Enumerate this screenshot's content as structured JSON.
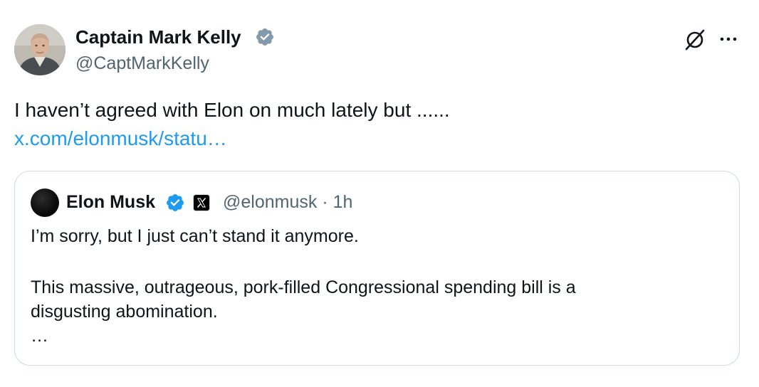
{
  "author": {
    "name": "Captain Mark Kelly",
    "handle": "@CaptMarkKelly",
    "verified_color": "#829aab"
  },
  "tweet": {
    "text": "I haven’t agreed with Elon on much lately but ......",
    "link": "x.com/elonmusk/statu…"
  },
  "quote": {
    "name": "Elon Musk",
    "verified_color": "#1d9bf0",
    "handle": "@elonmusk",
    "separator": "·",
    "time": "1h",
    "lines": [
      "I’m sorry, but I just can’t stand it anymore.",
      "This massive, outrageous, pork-filled Congressional spending bill is a",
      "disgusting abomination.",
      "…"
    ]
  },
  "icons": {
    "grok": "grok-icon",
    "more": "more-options-icon",
    "verified": "verified-badge-icon",
    "affiliate": "x-logo-icon"
  },
  "colors": {
    "text": "#0f1419",
    "secondary": "#536471",
    "link": "#1d9bf0",
    "border": "#cfd9de"
  }
}
